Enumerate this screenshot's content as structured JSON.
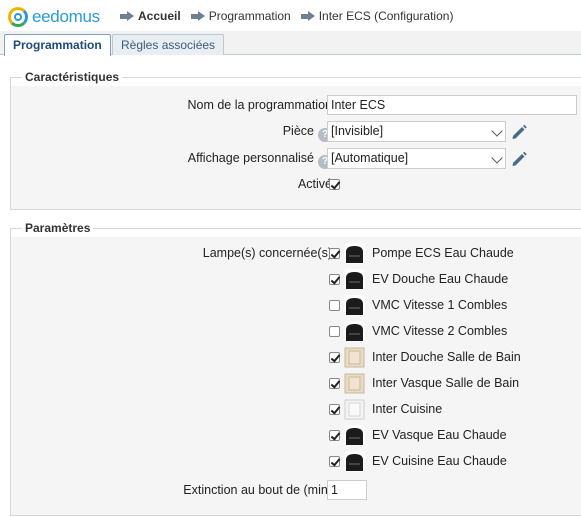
{
  "header": {
    "logo_text": "eedomus",
    "breadcrumb": [
      "Accueil",
      "Programmation",
      "Inter ECS (Configuration)"
    ]
  },
  "tabs": [
    {
      "label": "Programmation",
      "active": true
    },
    {
      "label": "Règles associées",
      "active": false
    }
  ],
  "caracteristiques": {
    "legend": "Caractéristiques",
    "name_label": "Nom de la programmation",
    "name_value": "Inter ECS",
    "piece_label": "Pièce",
    "piece_value": "[Invisible]",
    "affichage_label": "Affichage personnalisé",
    "affichage_value": "[Automatique]",
    "active_label": "Activé",
    "active_checked": true,
    "help_glyph": "?"
  },
  "parametres": {
    "legend": "Paramètres",
    "lamps_label": "Lampe(s) concernée(s)",
    "devices": [
      {
        "label": "Pompe ECS Eau Chaude",
        "checked": true,
        "icon": "zwave-module-icon"
      },
      {
        "label": "EV Douche Eau Chaude",
        "checked": true,
        "icon": "zwave-module-icon"
      },
      {
        "label": "VMC Vitesse 1 Combles",
        "checked": false,
        "icon": "zwave-module-icon"
      },
      {
        "label": "VMC Vitesse 2 Combles",
        "checked": false,
        "icon": "zwave-module-icon"
      },
      {
        "label": "Inter Douche Salle de Bain",
        "checked": true,
        "icon": "wall-switch-beige-icon"
      },
      {
        "label": "Inter Vasque Salle de Bain",
        "checked": true,
        "icon": "wall-switch-beige-icon"
      },
      {
        "label": "Inter Cuisine",
        "checked": true,
        "icon": "wall-switch-white-icon"
      },
      {
        "label": "EV Vasque Eau Chaude",
        "checked": true,
        "icon": "zwave-module-icon"
      },
      {
        "label": "EV Cuisine Eau Chaude",
        "checked": true,
        "icon": "zwave-module-icon"
      }
    ],
    "extinction_label": "Extinction au bout de (min)",
    "extinction_value": "1"
  },
  "colors": {
    "accent": "#2a9bd6",
    "tab_active_text": "#1e4a78",
    "fieldset_bg": "#f5f5f5"
  }
}
